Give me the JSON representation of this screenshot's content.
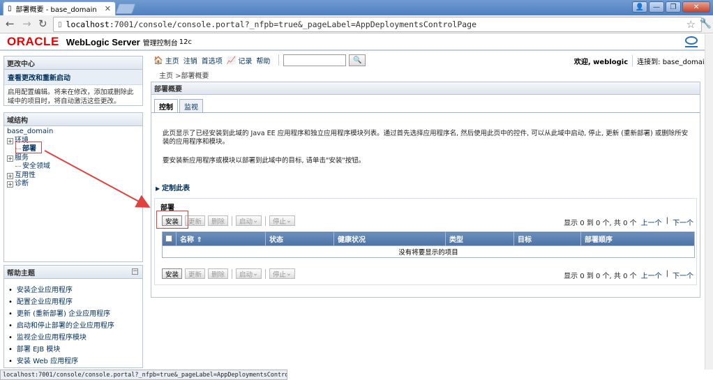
{
  "browser": {
    "tab_title": "部署概要 - base_domain",
    "url_host": "localhost",
    "url_rest": ":7001/console/console.portal?_nfpb=true&_pageLabel=AppDeploymentsControlPage",
    "status_url": "localhost:7001/console/console.portal?_nfpb=true&_pageLabel=AppDeploymentsControlPage"
  },
  "header": {
    "oracle": "ORACLE",
    "product": "WebLogic Server",
    "subtitle": "管理控制台",
    "version": "12c"
  },
  "change_center": {
    "title": "更改中心",
    "link": "查看更改和重新启动",
    "text": "启用配置编辑。将来在修改，添加或删除此域中的项目时，将自动激活这些更改。"
  },
  "domain_structure": {
    "title": "域结构",
    "root": "base_domain",
    "items": [
      {
        "label": "环境",
        "type": "expand"
      },
      {
        "label": "部署",
        "type": "leaf"
      },
      {
        "label": "服务",
        "type": "expand"
      },
      {
        "label": "安全领域",
        "type": "leaf"
      },
      {
        "label": "互用性",
        "type": "expand"
      },
      {
        "label": "诊断",
        "type": "expand"
      }
    ]
  },
  "help_topics": {
    "title": "帮助主题",
    "items": [
      "安装企业应用程序",
      "配置企业应用程序",
      "更新 (重新部署) 企业应用程序",
      "启动和停止部署的企业应用程序",
      "监视企业应用程序模块",
      "部署 EJB 模块",
      "安装 Web 应用程序"
    ]
  },
  "menu": {
    "home": "主页",
    "logout": "注销",
    "preferences": "首选项",
    "record": "记录",
    "help": "帮助",
    "welcome": "欢迎, weblogic",
    "connected": "连接到: base_domain"
  },
  "breadcrumb": "主页 >部署概要",
  "main": {
    "title": "部署概要",
    "tabs": [
      "控制",
      "监视"
    ],
    "description": "此页显示了已经安装到此域的 Java EE 应用程序和独立应用程序模块列表。通过首先选择应用程序名, 然后使用此页中的控件, 可以从此域中启动, 停止, 更新 (重新部署) 或删除所安装的应用程序和模块。",
    "install_hint": "要安装新应用程序或模块以部署到此域中的目标, 请单击\"安装\"按钮。",
    "customize": "定制此表",
    "deployments_title": "部署",
    "buttons": {
      "install": "安装",
      "update": "更新",
      "delete": "删除",
      "start": "启动",
      "stop": "停止"
    },
    "pager": {
      "summary": "显示 0 到 0 个, 共 0 个",
      "prev": "上一个",
      "next": "下一个"
    },
    "columns": [
      "名称",
      "状态",
      "健康状况",
      "类型",
      "目标",
      "部署顺序"
    ],
    "empty": "没有将要显示的项目"
  }
}
